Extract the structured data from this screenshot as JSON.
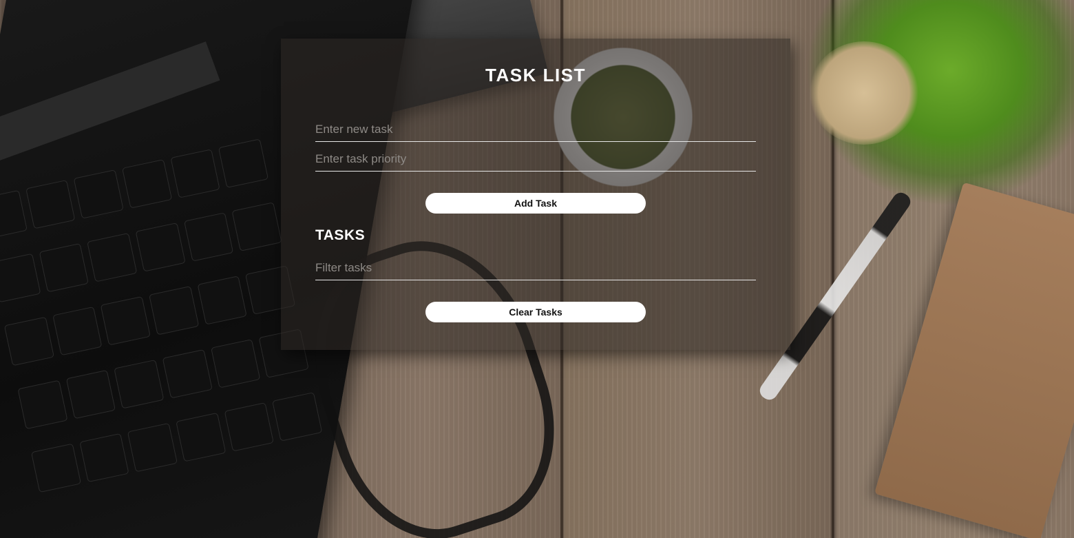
{
  "app": {
    "title": "TASK LIST"
  },
  "form": {
    "task_placeholder": "Enter new task",
    "task_value": "",
    "priority_placeholder": "Enter task priority",
    "priority_value": "",
    "add_button_label": "Add Task"
  },
  "tasks": {
    "heading": "TASKS",
    "filter_placeholder": "Filter tasks",
    "filter_value": "",
    "items": [],
    "clear_button_label": "Clear Tasks"
  },
  "colors": {
    "card_overlay": "#2d2824",
    "text": "#ffffff",
    "button_bg": "#ffffff",
    "button_text": "#111111"
  }
}
